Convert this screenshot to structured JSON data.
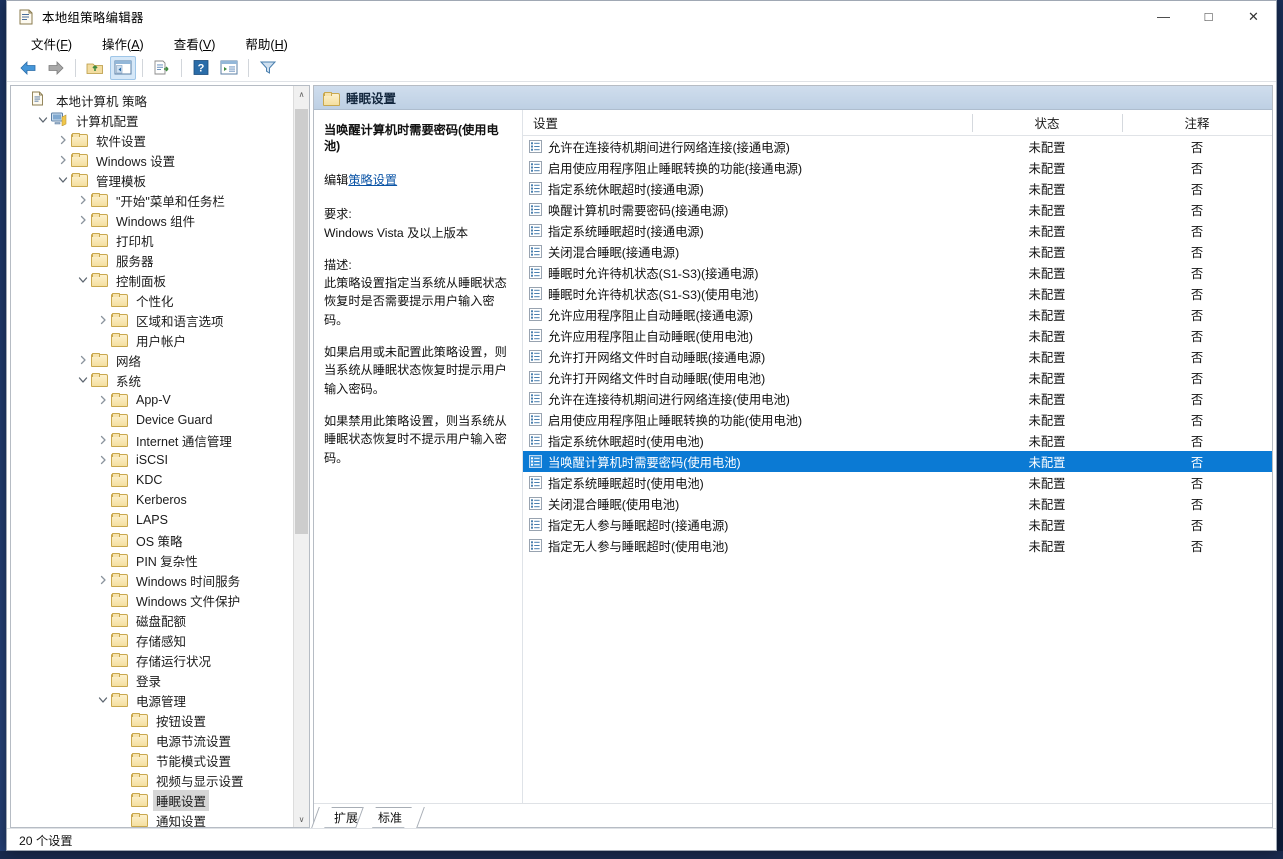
{
  "window": {
    "title": "本地组策略编辑器",
    "title_icon": "policy-editor-icon",
    "minimize_glyph": "—",
    "maximize_glyph": "□",
    "close_glyph": "✕"
  },
  "menubar": [
    {
      "label": "文件",
      "accel": "F",
      "name": "menu-file"
    },
    {
      "label": "操作",
      "accel": "A",
      "name": "menu-action"
    },
    {
      "label": "查看",
      "accel": "V",
      "name": "menu-view"
    },
    {
      "label": "帮助",
      "accel": "H",
      "name": "menu-help"
    }
  ],
  "toolbar": [
    {
      "name": "back-icon",
      "glyph": "back"
    },
    {
      "name": "forward-icon",
      "glyph": "forward"
    },
    {
      "name": "separator-1",
      "glyph": "sep"
    },
    {
      "name": "up-one-level-icon",
      "glyph": "up-folder"
    },
    {
      "name": "show-hide-console-tree-icon",
      "glyph": "console-tree",
      "active": true
    },
    {
      "name": "separator-2",
      "glyph": "sep"
    },
    {
      "name": "export-list-icon",
      "glyph": "export-list"
    },
    {
      "name": "separator-3",
      "glyph": "sep"
    },
    {
      "name": "help-icon",
      "glyph": "help"
    },
    {
      "name": "view-icon",
      "glyph": "view"
    },
    {
      "name": "separator-4",
      "glyph": "sep"
    },
    {
      "name": "filter-icon",
      "glyph": "filter"
    }
  ],
  "tree": {
    "root_label": "本地计算机 策略",
    "items": [
      {
        "label": "本地计算机 策略",
        "depth": 0,
        "twist": "none",
        "icon": "policy-root-icon",
        "selected": false
      },
      {
        "label": "计算机配置",
        "depth": 1,
        "twist": "expanded",
        "icon": "computer-icon",
        "selected": false
      },
      {
        "label": "软件设置",
        "depth": 2,
        "twist": "collapsed",
        "icon": "folder",
        "selected": false
      },
      {
        "label": "Windows 设置",
        "depth": 2,
        "twist": "collapsed",
        "icon": "folder",
        "selected": false
      },
      {
        "label": "管理模板",
        "depth": 2,
        "twist": "expanded",
        "icon": "folder",
        "selected": false
      },
      {
        "label": "\"开始\"菜单和任务栏",
        "depth": 3,
        "twist": "collapsed",
        "icon": "folder",
        "selected": false
      },
      {
        "label": "Windows 组件",
        "depth": 3,
        "twist": "collapsed",
        "icon": "folder",
        "selected": false
      },
      {
        "label": "打印机",
        "depth": 3,
        "twist": "none",
        "icon": "folder",
        "selected": false
      },
      {
        "label": "服务器",
        "depth": 3,
        "twist": "none",
        "icon": "folder",
        "selected": false
      },
      {
        "label": "控制面板",
        "depth": 3,
        "twist": "expanded",
        "icon": "folder",
        "selected": false
      },
      {
        "label": "个性化",
        "depth": 4,
        "twist": "none",
        "icon": "folder",
        "selected": false
      },
      {
        "label": "区域和语言选项",
        "depth": 4,
        "twist": "collapsed",
        "icon": "folder",
        "selected": false
      },
      {
        "label": "用户帐户",
        "depth": 4,
        "twist": "none",
        "icon": "folder",
        "selected": false
      },
      {
        "label": "网络",
        "depth": 3,
        "twist": "collapsed",
        "icon": "folder",
        "selected": false
      },
      {
        "label": "系统",
        "depth": 3,
        "twist": "expanded",
        "icon": "folder",
        "selected": false
      },
      {
        "label": "App-V",
        "depth": 4,
        "twist": "collapsed",
        "icon": "folder",
        "selected": false
      },
      {
        "label": "Device Guard",
        "depth": 4,
        "twist": "none",
        "icon": "folder",
        "selected": false
      },
      {
        "label": "Internet 通信管理",
        "depth": 4,
        "twist": "collapsed",
        "icon": "folder",
        "selected": false
      },
      {
        "label": "iSCSI",
        "depth": 4,
        "twist": "collapsed",
        "icon": "folder",
        "selected": false
      },
      {
        "label": "KDC",
        "depth": 4,
        "twist": "none",
        "icon": "folder",
        "selected": false
      },
      {
        "label": "Kerberos",
        "depth": 4,
        "twist": "none",
        "icon": "folder",
        "selected": false
      },
      {
        "label": "LAPS",
        "depth": 4,
        "twist": "none",
        "icon": "folder",
        "selected": false
      },
      {
        "label": "OS 策略",
        "depth": 4,
        "twist": "none",
        "icon": "folder",
        "selected": false
      },
      {
        "label": "PIN 复杂性",
        "depth": 4,
        "twist": "none",
        "icon": "folder",
        "selected": false
      },
      {
        "label": "Windows 时间服务",
        "depth": 4,
        "twist": "collapsed",
        "icon": "folder",
        "selected": false
      },
      {
        "label": "Windows 文件保护",
        "depth": 4,
        "twist": "none",
        "icon": "folder",
        "selected": false
      },
      {
        "label": "磁盘配额",
        "depth": 4,
        "twist": "none",
        "icon": "folder",
        "selected": false
      },
      {
        "label": "存储感知",
        "depth": 4,
        "twist": "none",
        "icon": "folder",
        "selected": false
      },
      {
        "label": "存储运行状况",
        "depth": 4,
        "twist": "none",
        "icon": "folder",
        "selected": false
      },
      {
        "label": "登录",
        "depth": 4,
        "twist": "none",
        "icon": "folder",
        "selected": false
      },
      {
        "label": "电源管理",
        "depth": 4,
        "twist": "expanded",
        "icon": "folder",
        "selected": false
      },
      {
        "label": "按钮设置",
        "depth": 5,
        "twist": "none",
        "icon": "folder",
        "selected": false
      },
      {
        "label": "电源节流设置",
        "depth": 5,
        "twist": "none",
        "icon": "folder",
        "selected": false
      },
      {
        "label": "节能模式设置",
        "depth": 5,
        "twist": "none",
        "icon": "folder",
        "selected": false
      },
      {
        "label": "视频与显示设置",
        "depth": 5,
        "twist": "none",
        "icon": "folder",
        "selected": false
      },
      {
        "label": "睡眠设置",
        "depth": 5,
        "twist": "none",
        "icon": "folder",
        "selected": true
      },
      {
        "label": "通知设置",
        "depth": 5,
        "twist": "none",
        "icon": "folder",
        "selected": false
      }
    ],
    "scrollbar": {
      "up_glyph": "∧",
      "down_glyph": "∨",
      "thumb_top_pct": 1,
      "thumb_height_pct": 60
    }
  },
  "right_pane": {
    "header_title": "睡眠设置",
    "header_icon": "folder",
    "help": {
      "title": "当唤醒计算机时需要密码(使用电池)",
      "edit_prefix": "编辑",
      "edit_link": "策略设置",
      "requirements_label": "要求:",
      "requirements_value": "Windows Vista 及以上版本",
      "description_label": "描述:",
      "paragraphs": [
        "此策略设置指定当系统从睡眠状态恢复时是否需要提示用户输入密码。",
        "如果启用或未配置此策略设置，则当系统从睡眠状态恢复时提示用户输入密码。",
        "如果禁用此策略设置，则当系统从睡眠状态恢复时不提示用户输入密码。"
      ]
    },
    "list": {
      "columns": [
        "设置",
        "状态",
        "注释"
      ],
      "rows": [
        {
          "setting": "允许在连接待机期间进行网络连接(接通电源)",
          "state": "未配置",
          "note": "否",
          "selected": false
        },
        {
          "setting": "启用使应用程序阻止睡眠转换的功能(接通电源)",
          "state": "未配置",
          "note": "否",
          "selected": false
        },
        {
          "setting": "指定系统休眠超时(接通电源)",
          "state": "未配置",
          "note": "否",
          "selected": false
        },
        {
          "setting": "唤醒计算机时需要密码(接通电源)",
          "state": "未配置",
          "note": "否",
          "selected": false
        },
        {
          "setting": "指定系统睡眠超时(接通电源)",
          "state": "未配置",
          "note": "否",
          "selected": false
        },
        {
          "setting": "关闭混合睡眠(接通电源)",
          "state": "未配置",
          "note": "否",
          "selected": false
        },
        {
          "setting": "睡眠时允许待机状态(S1-S3)(接通电源)",
          "state": "未配置",
          "note": "否",
          "selected": false
        },
        {
          "setting": "睡眠时允许待机状态(S1-S3)(使用电池)",
          "state": "未配置",
          "note": "否",
          "selected": false
        },
        {
          "setting": "允许应用程序阻止自动睡眠(接通电源)",
          "state": "未配置",
          "note": "否",
          "selected": false
        },
        {
          "setting": "允许应用程序阻止自动睡眠(使用电池)",
          "state": "未配置",
          "note": "否",
          "selected": false
        },
        {
          "setting": "允许打开网络文件时自动睡眠(接通电源)",
          "state": "未配置",
          "note": "否",
          "selected": false
        },
        {
          "setting": "允许打开网络文件时自动睡眠(使用电池)",
          "state": "未配置",
          "note": "否",
          "selected": false
        },
        {
          "setting": "允许在连接待机期间进行网络连接(使用电池)",
          "state": "未配置",
          "note": "否",
          "selected": false
        },
        {
          "setting": "启用使应用程序阻止睡眠转换的功能(使用电池)",
          "state": "未配置",
          "note": "否",
          "selected": false
        },
        {
          "setting": "指定系统休眠超时(使用电池)",
          "state": "未配置",
          "note": "否",
          "selected": false
        },
        {
          "setting": "当唤醒计算机时需要密码(使用电池)",
          "state": "未配置",
          "note": "否",
          "selected": true
        },
        {
          "setting": "指定系统睡眠超时(使用电池)",
          "state": "未配置",
          "note": "否",
          "selected": false
        },
        {
          "setting": "关闭混合睡眠(使用电池)",
          "state": "未配置",
          "note": "否",
          "selected": false
        },
        {
          "setting": "指定无人参与睡眠超时(接通电源)",
          "state": "未配置",
          "note": "否",
          "selected": false
        },
        {
          "setting": "指定无人参与睡眠超时(使用电池)",
          "state": "未配置",
          "note": "否",
          "selected": false
        }
      ]
    }
  },
  "tabs": [
    {
      "label": "扩展",
      "name": "tab-extended",
      "active": true
    },
    {
      "label": "标准",
      "name": "tab-standard",
      "active": false
    }
  ],
  "statusbar": {
    "text": "20 个设置"
  },
  "colors": {
    "selection_blue": "#0b7ad4",
    "tree_selection_gray": "#d6d6d6",
    "link_blue": "#0b54a6",
    "header_gradient_top": "#cfdded",
    "header_gradient_bottom": "#bed0e4",
    "desktop_blue": "#1b3463"
  }
}
